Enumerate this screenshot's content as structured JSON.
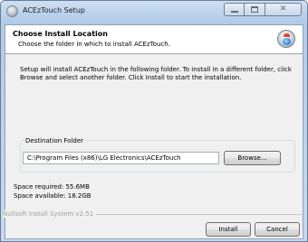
{
  "window": {
    "title": "ACEzTouch Setup"
  },
  "header": {
    "title": "Choose Install Location",
    "subtitle": "Choose the folder in which to install ACEzTouch."
  },
  "description": "Setup will install ACEzTouch in the following folder. To install in a different folder, click Browse and select another folder. Click Install to start the installation.",
  "destination": {
    "group_label": "Destination Folder",
    "path": "C:\\Program Files (x86)\\LG Electronics\\ACEzTouch",
    "browse_label": "Browse..."
  },
  "space": {
    "required": "Space required: 55.6MB",
    "available": "Space available: 18.2GB"
  },
  "footer": {
    "brand": "Nullsoft Install System v2.51",
    "install_label": "Install",
    "cancel_label": "Cancel"
  },
  "icons": {
    "app": "setup-disc-icon",
    "minimize": "minimize-icon",
    "maximize": "maximize-icon",
    "close": "close-icon"
  }
}
